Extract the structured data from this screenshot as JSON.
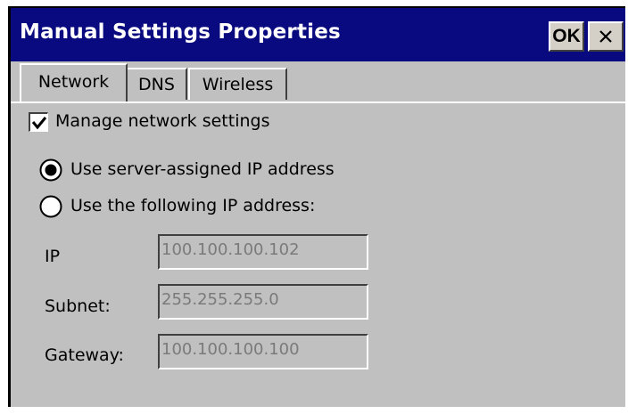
{
  "window": {
    "title": "Manual Settings Properties",
    "ok_label": "OK",
    "close_icon": "close-icon"
  },
  "tabs": [
    {
      "label": "Network",
      "active": true
    },
    {
      "label": "DNS",
      "active": false
    },
    {
      "label": "Wireless",
      "active": false
    }
  ],
  "network": {
    "manage_checkbox": {
      "label": "Manage network settings",
      "checked": true
    },
    "radio_server": {
      "label": "Use server-assigned IP address",
      "selected": true
    },
    "radio_manual": {
      "label": "Use the following IP address:",
      "selected": false
    },
    "fields": {
      "ip": {
        "label": "IP",
        "value": "100.100.100.102"
      },
      "subnet": {
        "label": "Subnet:",
        "value": "255.255.255.0"
      },
      "gateway": {
        "label": "Gateway:",
        "value": "100.100.100.100"
      }
    }
  },
  "colors": {
    "titlebar": "#0a0a80",
    "face": "#c0c0c0",
    "disabled_text": "#7a7a7a"
  }
}
